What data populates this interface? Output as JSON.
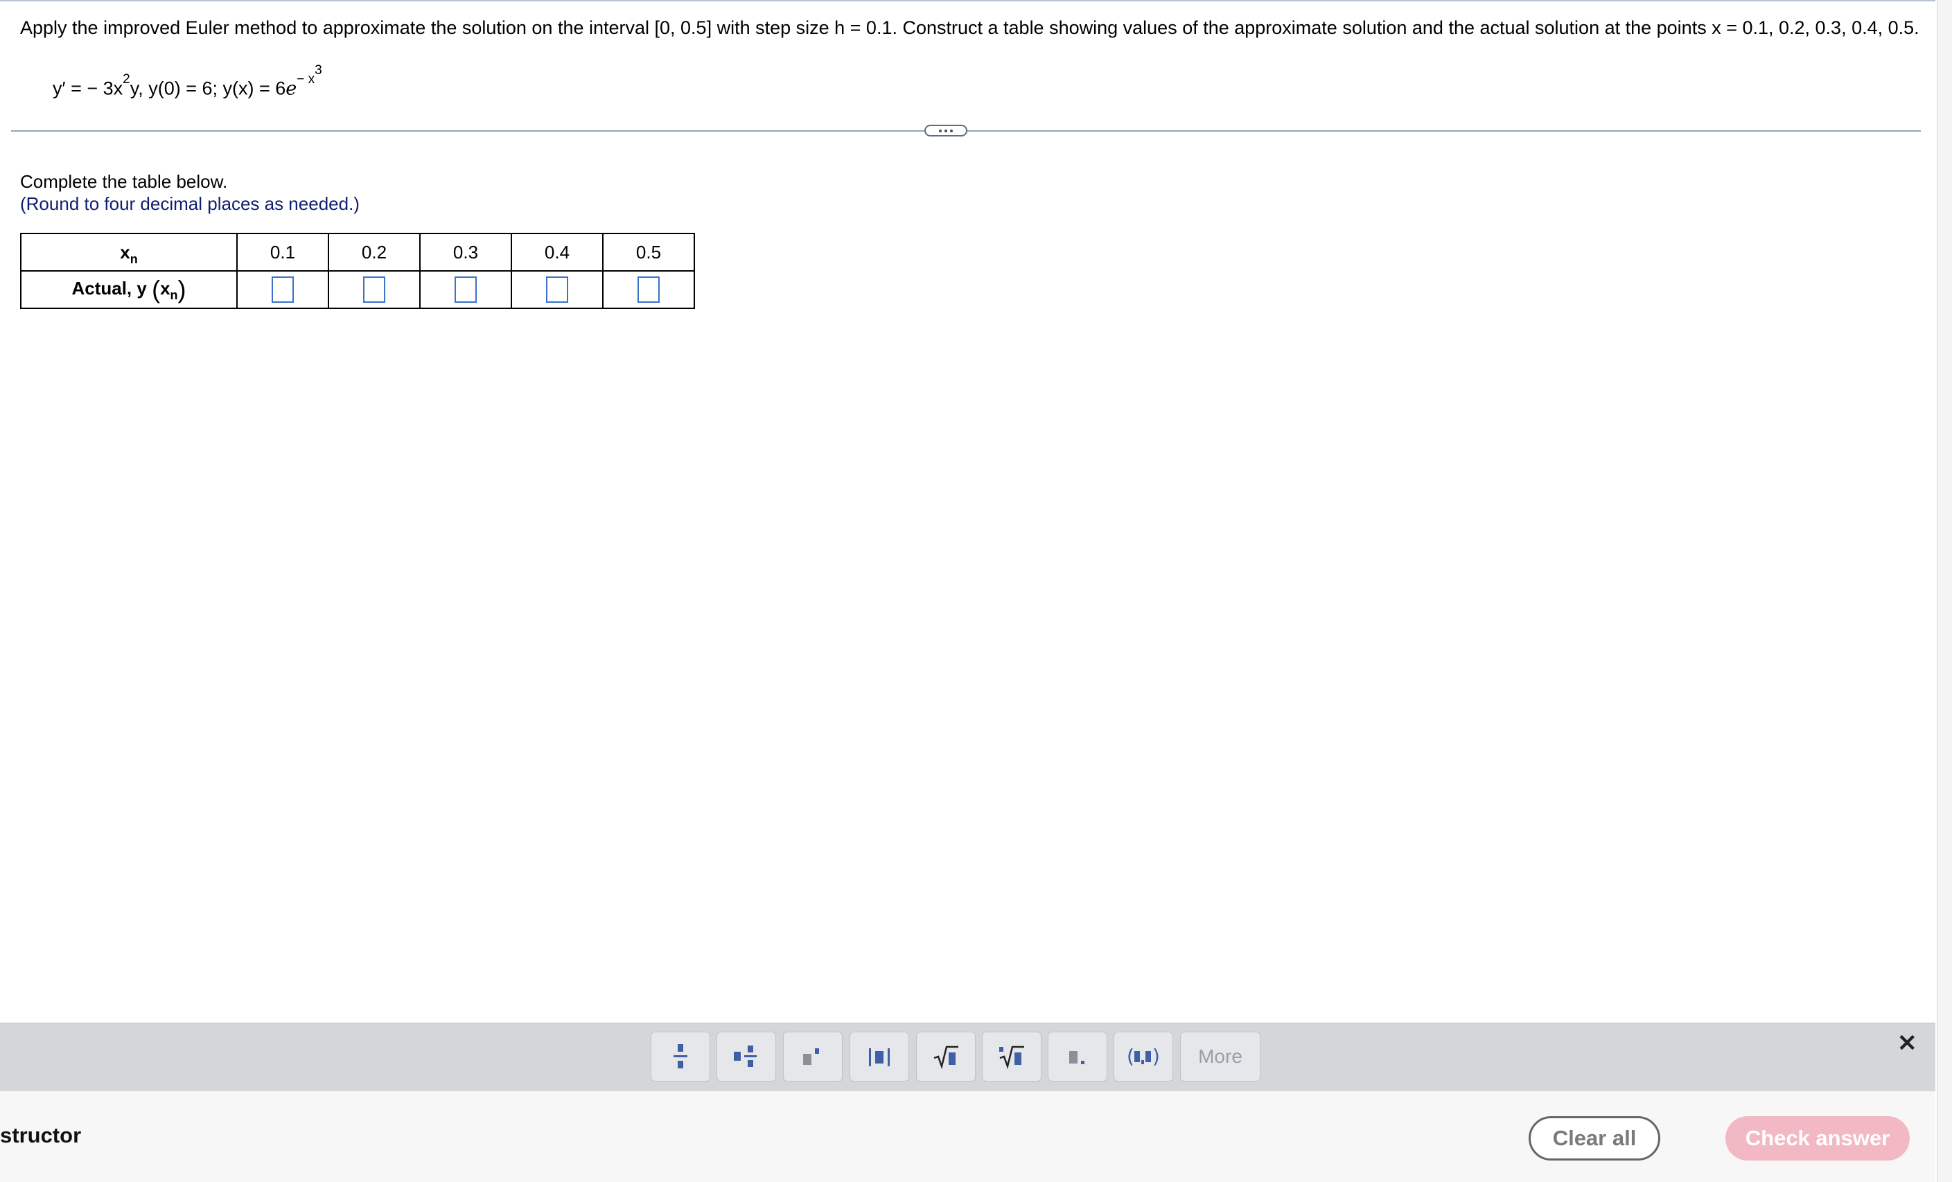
{
  "problem": {
    "text": "Apply the improved Euler method to approximate the solution on the interval [0, 0.5] with step size h = 0.1. Construct a table showing values of the approximate solution and the actual solution at the points x = 0.1, 0.2, 0.3, 0.4, 0.5.",
    "eq_part1": "y′ = − 3x",
    "eq_exp1": "2",
    "eq_part2": "y, y(0) = 6; y(x) = 6",
    "eq_e": "e",
    "eq_exp2": "− x",
    "eq_exp3": "3"
  },
  "instructions": {
    "complete": "Complete the table below.",
    "round": "(Round to four decimal places as needed.)"
  },
  "table": {
    "row1_header_main": "x",
    "row1_header_sub": "n",
    "row2_header_prefix": "Actual, y ",
    "row2_header_open": "(",
    "row2_header_x": "x",
    "row2_header_sub": "n",
    "row2_header_close": ")",
    "columns": [
      "0.1",
      "0.2",
      "0.3",
      "0.4",
      "0.5"
    ]
  },
  "toolbar": {
    "buttons": [
      "fraction-icon",
      "mixed-number-icon",
      "exponent-icon",
      "absolute-value-icon",
      "square-root-icon",
      "nth-root-icon",
      "decimal-icon",
      "ordered-pair-icon"
    ],
    "more_label": "More",
    "icon_color": "#3f5fa6"
  },
  "footer": {
    "instructor_label": "structor",
    "clear_all_label": "Clear all",
    "check_answer_label": "Check answer",
    "check_answer_color": "#f2b8c3"
  }
}
